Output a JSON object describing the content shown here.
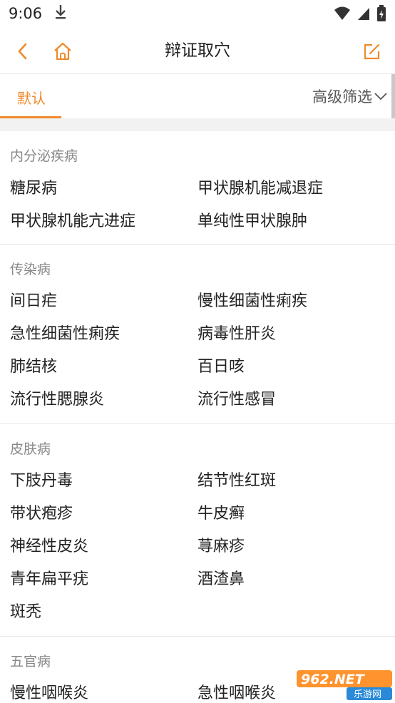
{
  "status_bar": {
    "time": "9:06"
  },
  "header": {
    "title": "辩证取穴"
  },
  "tabs": {
    "default_label": "默认",
    "filter_label": "高级筛选"
  },
  "sections": [
    {
      "title": "内分泌疾病",
      "items": [
        "糖尿病",
        "甲状腺机能减退症",
        "甲状腺机能亢进症",
        "单纯性甲状腺肿"
      ]
    },
    {
      "title": "传染病",
      "items": [
        "间日疟",
        "慢性细菌性痢疾",
        "急性细菌性痢疾",
        "病毒性肝炎",
        "肺结核",
        "百日咳",
        "流行性腮腺炎",
        "流行性感冒"
      ]
    },
    {
      "title": "皮肤病",
      "items": [
        "下肢丹毒",
        "结节性红斑",
        "带状疱疹",
        "牛皮癣",
        "神经性皮炎",
        "荨麻疹",
        "青年扁平疣",
        "酒渣鼻",
        "斑秃"
      ]
    },
    {
      "title": "五官病",
      "items": [
        "慢性咽喉炎",
        "急性咽喉炎"
      ]
    }
  ],
  "watermark": {
    "text_main": "962.NET",
    "text_sub": "乐游网"
  },
  "colors": {
    "accent": "#f08a2a",
    "text": "#222222",
    "muted": "#888888",
    "divider": "#e6e6e6"
  }
}
